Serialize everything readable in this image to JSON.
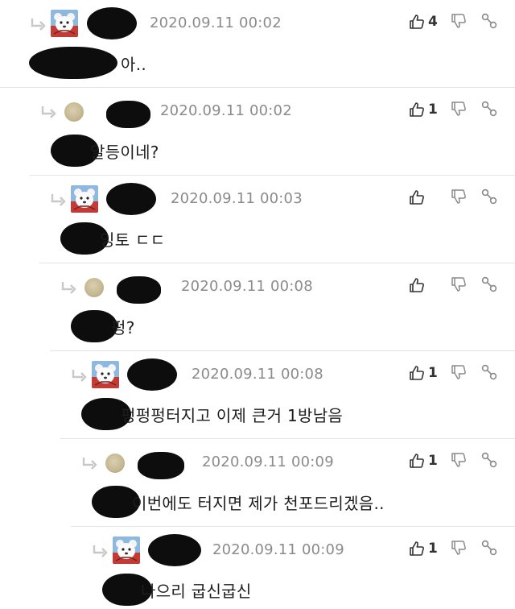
{
  "comments": [
    {
      "avatar": "bear-avatar-icon",
      "time": "2020.09.11 00:02",
      "likes": "4",
      "text": "아.."
    },
    {
      "avatar": "round-avatar-icon",
      "time": "2020.09.11 00:02",
      "likes": "1",
      "text": "알등이네?"
    },
    {
      "avatar": "bear-avatar-icon",
      "time": "2020.09.11 00:03",
      "likes": "",
      "text": "잉토 ㄷㄷ"
    },
    {
      "avatar": "round-avatar-icon",
      "time": "2020.09.11 00:08",
      "likes": "",
      "text": "펑?"
    },
    {
      "avatar": "bear-avatar-icon",
      "time": "2020.09.11 00:08",
      "likes": "1",
      "text": "펑펑펑터지고 이제 큰거 1방남음"
    },
    {
      "avatar": "round-avatar-icon",
      "time": "2020.09.11 00:09",
      "likes": "1",
      "text": "이번에도 터지면 제가 천포드리겠음.."
    },
    {
      "avatar": "bear-avatar-icon",
      "time": "2020.09.11 00:09",
      "likes": "1",
      "text": "나으리 굽신굽신"
    }
  ],
  "colors": {
    "timestamp": "#8b8b8b",
    "divider": "#e4e4e4",
    "icon": "#6f6f6f",
    "redaction": "#0d0d0d"
  }
}
